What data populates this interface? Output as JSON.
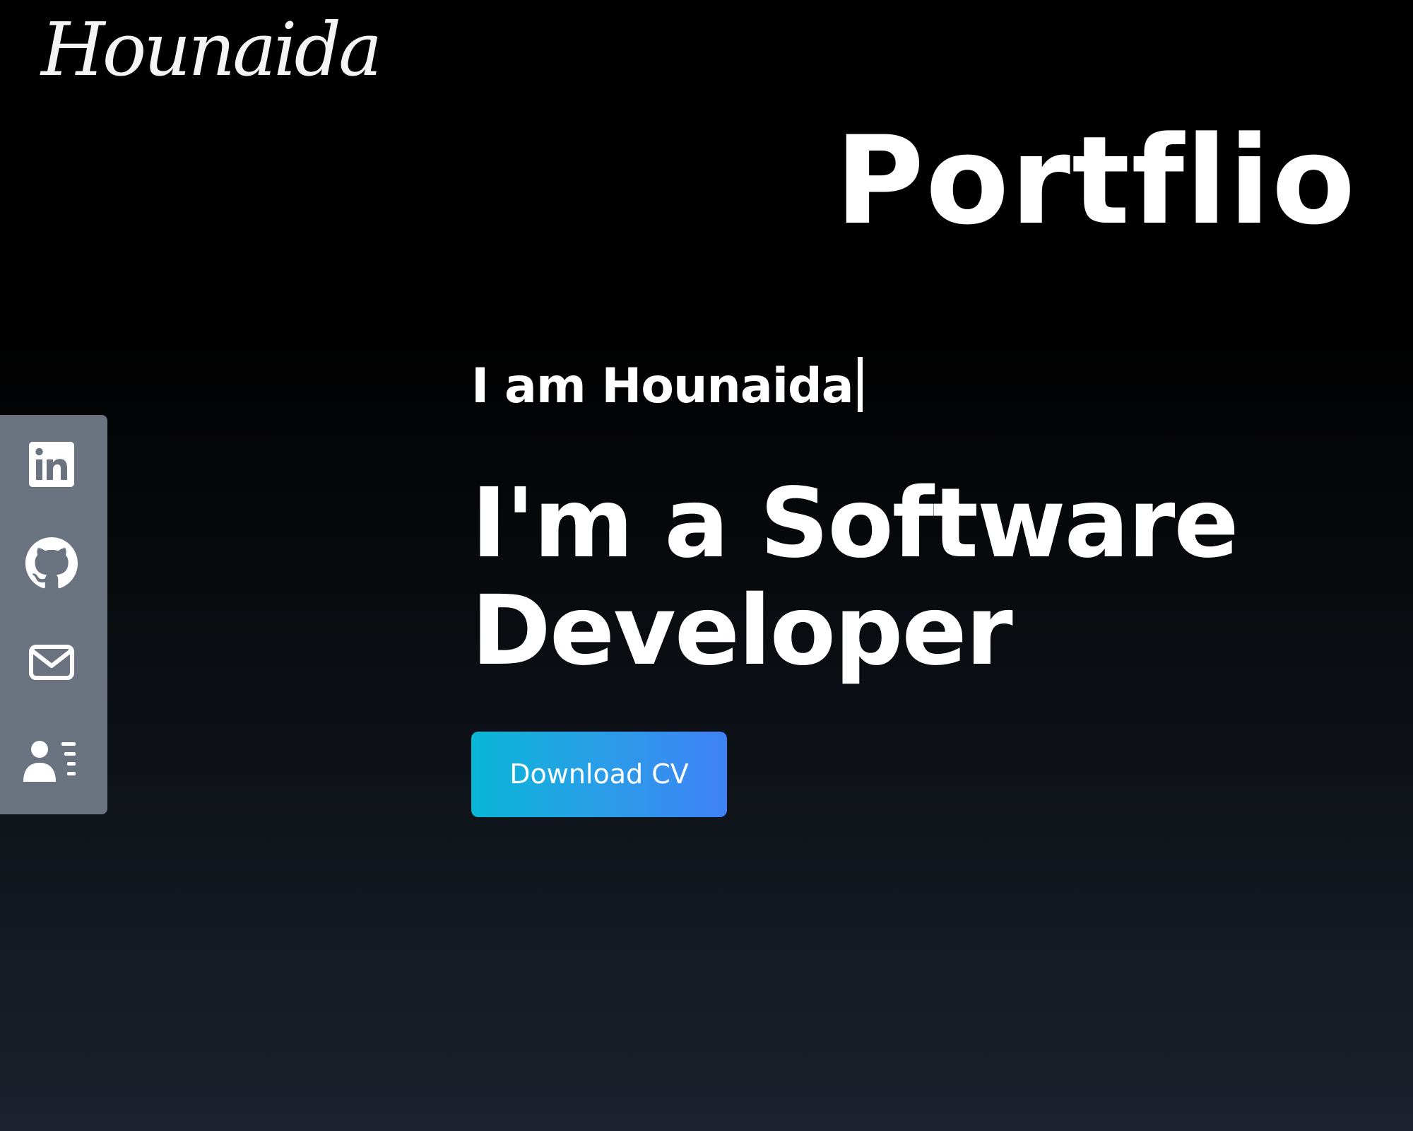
{
  "brand": {
    "logo_text": "Hounaida"
  },
  "overlay": {
    "title": "Portflio"
  },
  "social": {
    "items": [
      {
        "name": "linkedin",
        "icon": "linkedin-icon"
      },
      {
        "name": "github",
        "icon": "github-icon"
      },
      {
        "name": "email",
        "icon": "envelope-icon"
      },
      {
        "name": "profile",
        "icon": "user-list-icon"
      }
    ],
    "background_color": "#6b7280"
  },
  "hero": {
    "intro": "I am Hounaida",
    "headline_line1": "I'm a Software",
    "headline_line2": "Developer",
    "cta_label": "Download CV",
    "cta_gradient": [
      "#08b6d6",
      "#3f82f6"
    ]
  },
  "colors": {
    "background_top": "#000000",
    "background_bottom": "#1b222d",
    "text": "#ffffff"
  }
}
